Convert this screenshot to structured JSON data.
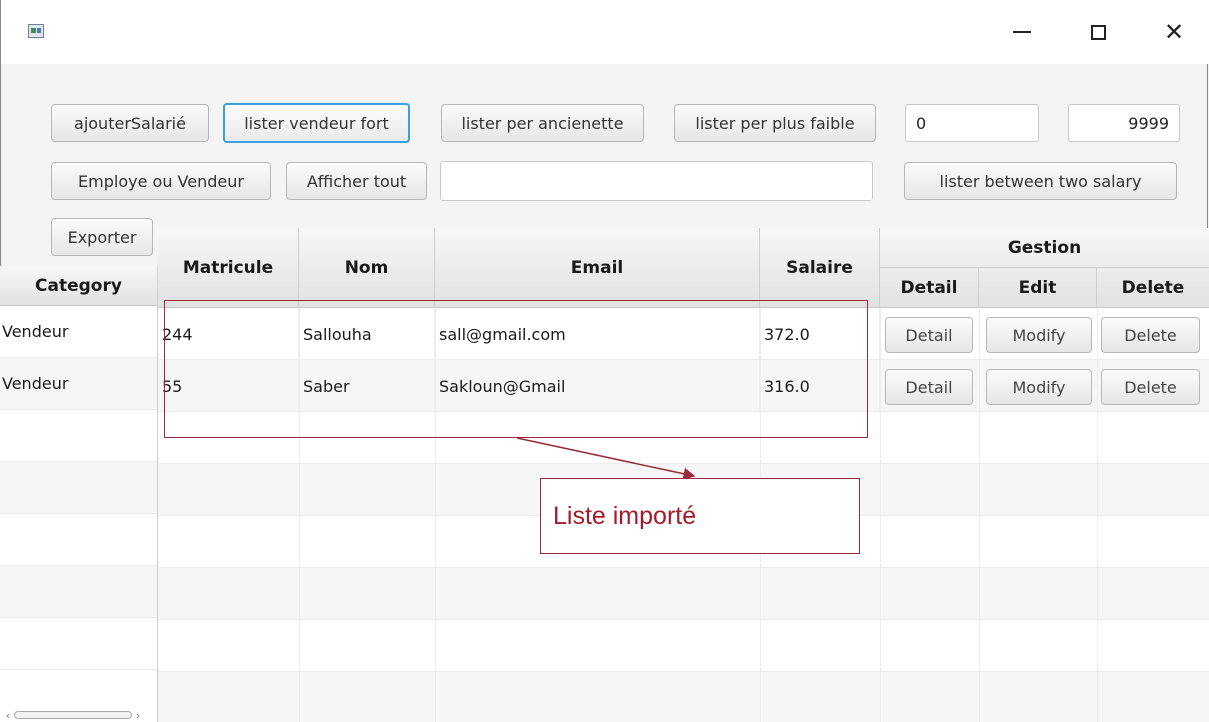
{
  "window": {
    "title": ""
  },
  "toolbar": {
    "ajouter": "ajouterSalarié",
    "lister_fort": "lister vendeur fort",
    "lister_anciennete": "lister per ancienette",
    "lister_faible": "lister per plus faible",
    "employe_vendeur": "Employe ou Vendeur",
    "afficher_tout": "Afficher tout",
    "exporter": "Exporter",
    "lister_between": "lister between two salary",
    "search_value": "",
    "min_salary": "0",
    "max_salary": "9999"
  },
  "table": {
    "headers": {
      "category": "Category",
      "matricule": "Matricule",
      "nom": "Nom",
      "email": "Email",
      "salaire": "Salaire",
      "gestion": "Gestion",
      "detail": "Detail",
      "edit": "Edit",
      "delete": "Delete"
    },
    "rows": [
      {
        "category": "Vendeur",
        "matricule": "244",
        "nom": "Sallouha",
        "email": "sall@gmail.com",
        "salaire": "372.0",
        "detail_btn": "Detail",
        "modify_btn": "Modify",
        "delete_btn": "Delete"
      },
      {
        "category": "Vendeur",
        "matricule": "55",
        "nom": "Saber",
        "email": "Sakloun@Gmail",
        "salaire": "316.0",
        "detail_btn": "Detail",
        "modify_btn": "Modify",
        "delete_btn": "Delete"
      }
    ]
  },
  "annotation": {
    "label": "Liste importé",
    "color": "#a31c2b"
  }
}
